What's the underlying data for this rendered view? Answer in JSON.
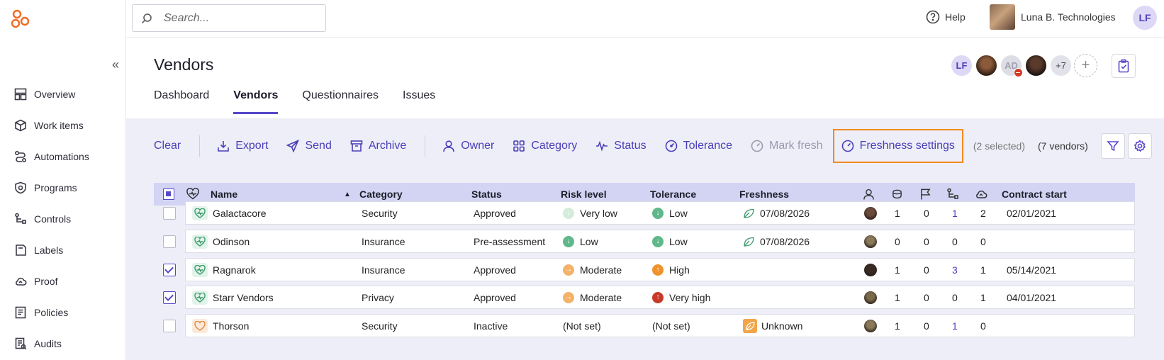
{
  "search": {
    "placeholder": "Search..."
  },
  "topbar": {
    "help_label": "Help",
    "org_name": "Luna B. Technologies",
    "user_initials": "LF"
  },
  "sidebar": {
    "items": [
      {
        "label": "Overview",
        "icon": "overview-icon"
      },
      {
        "label": "Work items",
        "icon": "cube-icon"
      },
      {
        "label": "Automations",
        "icon": "automations-icon"
      },
      {
        "label": "Programs",
        "icon": "shield-icon"
      },
      {
        "label": "Controls",
        "icon": "controls-icon"
      },
      {
        "label": "Labels",
        "icon": "labels-icon"
      },
      {
        "label": "Proof",
        "icon": "cloud-icon"
      },
      {
        "label": "Policies",
        "icon": "policies-icon"
      },
      {
        "label": "Audits",
        "icon": "audits-icon"
      }
    ]
  },
  "page": {
    "title": "Vendors",
    "tabs": [
      {
        "label": "Dashboard",
        "active": false
      },
      {
        "label": "Vendors",
        "active": true
      },
      {
        "label": "Questionnaires",
        "active": false
      },
      {
        "label": "Issues",
        "active": false
      }
    ],
    "members": {
      "lf": "LF",
      "ad": "AD",
      "more": "+7",
      "add": "+"
    }
  },
  "toolbar": {
    "clear": "Clear",
    "export": "Export",
    "send": "Send",
    "archive": "Archive",
    "owner": "Owner",
    "category": "Category",
    "status": "Status",
    "tolerance": "Tolerance",
    "mark_fresh": "Mark fresh",
    "freshness_settings": "Freshness settings",
    "selected": "(2 selected)",
    "vendors_count": "(7 vendors)"
  },
  "table": {
    "headers": {
      "name": "Name",
      "category": "Category",
      "status": "Status",
      "risk": "Risk level",
      "tolerance": "Tolerance",
      "freshness": "Freshness",
      "contract_start": "Contract start"
    },
    "rows": [
      {
        "checked": false,
        "health": "green",
        "name": "Galactacore",
        "category": "Security",
        "status": "Approved",
        "risk": "Very low",
        "risk_level": "vlow",
        "tolerance": "Low",
        "tol_level": "low",
        "freshness": "07/08/2026",
        "fresh_state": "leaf",
        "c1": "1",
        "c2": "0",
        "c3": "1",
        "c3_link": true,
        "c4": "2",
        "contract": "02/01/2021"
      },
      {
        "checked": false,
        "health": "green",
        "name": "Odinson",
        "category": "Insurance",
        "status": "Pre-assessment",
        "risk": "Low",
        "risk_level": "low",
        "tolerance": "Low",
        "tol_level": "low",
        "freshness": "07/08/2026",
        "fresh_state": "leaf",
        "c1": "0",
        "c2": "0",
        "c3": "0",
        "c3_link": false,
        "c4": "0",
        "contract": ""
      },
      {
        "checked": true,
        "health": "green",
        "name": "Ragnarok",
        "category": "Insurance",
        "status": "Approved",
        "risk": "Moderate",
        "risk_level": "mod",
        "tolerance": "High",
        "tol_level": "high",
        "freshness": "",
        "fresh_state": "none",
        "c1": "1",
        "c2": "0",
        "c3": "3",
        "c3_link": true,
        "c4": "1",
        "contract": "05/14/2021"
      },
      {
        "checked": true,
        "health": "green",
        "name": "Starr Vendors",
        "category": "Privacy",
        "status": "Approved",
        "risk": "Moderate",
        "risk_level": "mod",
        "tolerance": "Very high",
        "tol_level": "vhigh",
        "freshness": "",
        "fresh_state": "none",
        "c1": "1",
        "c2": "0",
        "c3": "0",
        "c3_link": false,
        "c4": "1",
        "contract": "04/01/2021"
      },
      {
        "checked": false,
        "health": "orange",
        "name": "Thorson",
        "category": "Security",
        "status": "Inactive",
        "risk": "(Not set)",
        "risk_level": "none",
        "tolerance": "(Not set)",
        "tol_level": "none",
        "freshness": "Unknown",
        "fresh_state": "unknown",
        "c1": "1",
        "c2": "0",
        "c3": "1",
        "c3_link": true,
        "c4": "0",
        "contract": ""
      }
    ]
  },
  "colors": {
    "accent": "#5848c8",
    "highlight": "#f08a24",
    "header_bg": "#d3d4f3",
    "panel_bg": "#eeeef8"
  }
}
